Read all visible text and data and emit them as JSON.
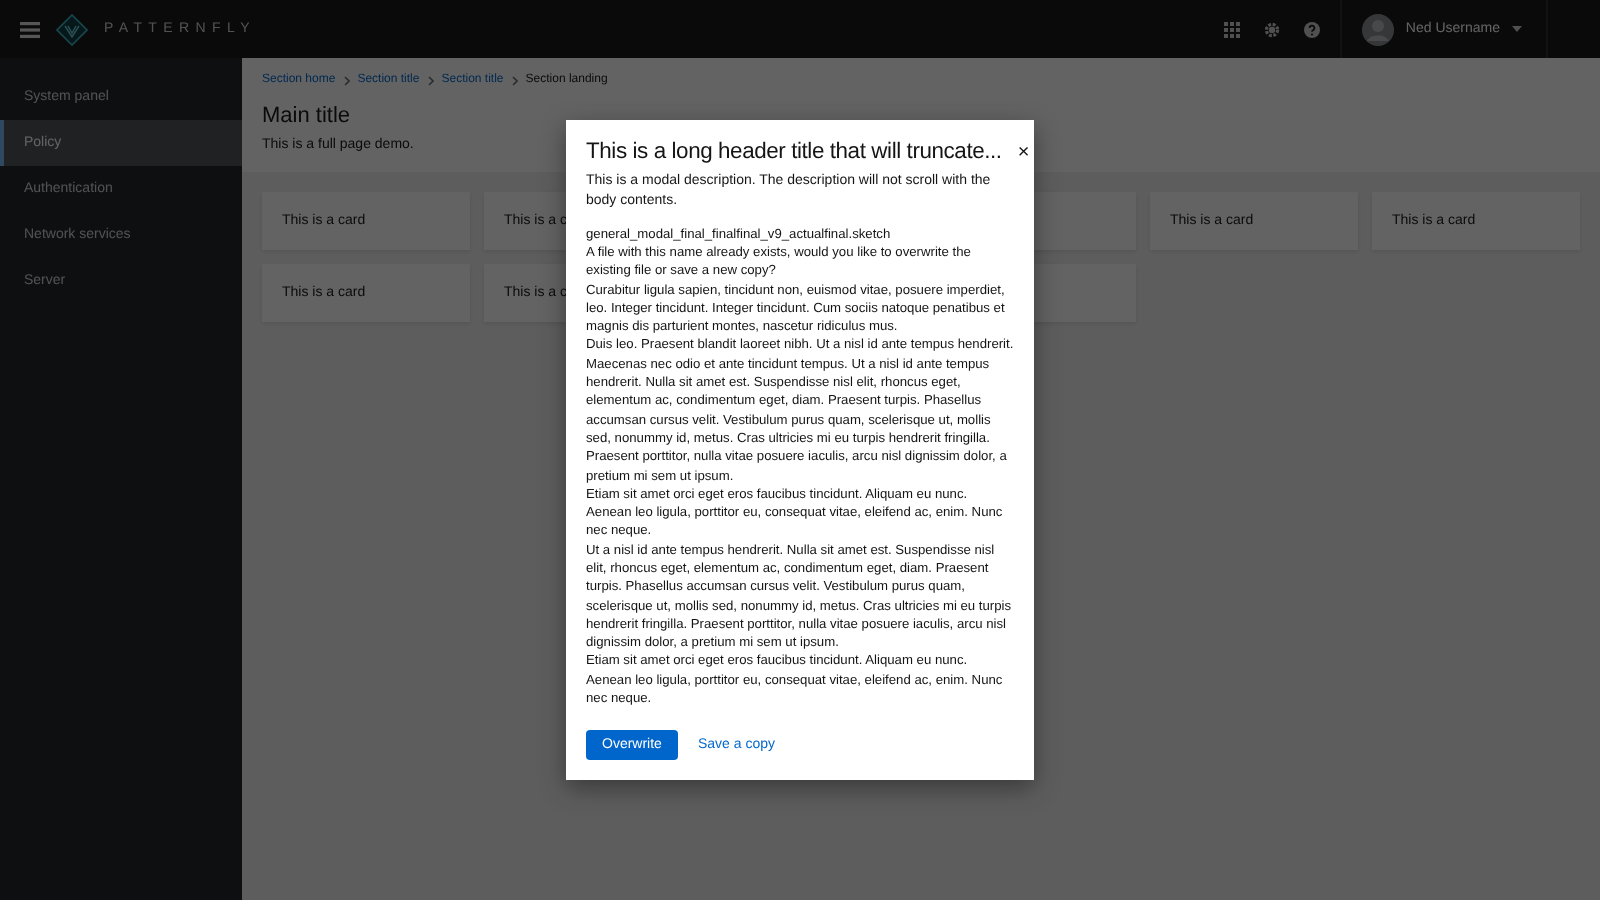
{
  "masthead": {
    "brand": "PATTERNFLY",
    "user": "Ned Username"
  },
  "sidebar": {
    "items": [
      {
        "label": "System panel",
        "selected": false
      },
      {
        "label": "Policy",
        "selected": true
      },
      {
        "label": "Authentication",
        "selected": false
      },
      {
        "label": "Network services",
        "selected": false
      },
      {
        "label": "Server",
        "selected": false
      }
    ]
  },
  "breadcrumb": [
    {
      "label": "Section home",
      "kind": "link"
    },
    {
      "label": "Section title",
      "kind": "link"
    },
    {
      "label": "Section title",
      "kind": "link"
    },
    {
      "label": "Section landing",
      "kind": "current"
    }
  ],
  "page": {
    "title": "Main title",
    "description": "This is a full page demo."
  },
  "card_rows": [
    {
      "cards": [
        {
          "kind": "text",
          "label": "This is a card"
        },
        {
          "kind": "text",
          "label": "This is a c"
        },
        {
          "kind": "covered"
        },
        {
          "kind": "covered"
        },
        {
          "kind": "text",
          "label": "This is a card"
        },
        {
          "kind": "text",
          "label": "This is a card"
        }
      ]
    },
    {
      "cards": [
        {
          "kind": "text",
          "label": "This is a card"
        },
        {
          "kind": "text",
          "label": "This is a c"
        },
        {
          "kind": "covered"
        },
        {
          "kind": "covered"
        }
      ]
    }
  ],
  "modal": {
    "title": "This is a long header title that will truncate...",
    "close": "×",
    "description": "This is a modal description. The description will not scroll with the body contents.",
    "filename": "general_modal_final_finalfinal_v9_actualfinal.sketch",
    "paragraphs": [
      "A file with this name already exists, would you like to overwrite the existing file or save a new copy?",
      "Curabitur ligula sapien, tincidunt non, euismod vitae, posuere imperdiet, leo. Integer tincidunt. Integer tincidunt. Cum sociis natoque penatibus et magnis dis parturient montes, nascetur ridiculus mus.",
      "Duis leo. Praesent blandit laoreet nibh. Ut a nisl id ante tempus hendrerit. Maecenas nec odio et ante tincidunt tempus. Ut a nisl id ante tempus hendrerit. Nulla sit amet est. Suspendisse nisl elit, rhoncus eget, elementum ac, condimentum eget, diam. Praesent turpis. Phasellus accumsan cursus velit. Vestibulum purus quam, scelerisque ut, mollis sed, nonummy id, metus. Cras ultricies mi eu turpis hendrerit fringilla. Praesent porttitor, nulla vitae posuere iaculis, arcu nisl dignissim dolor, a pretium mi sem ut ipsum.",
      "Etiam sit amet orci eget eros faucibus tincidunt. Aliquam eu nunc. Aenean leo ligula, porttitor eu, consequat vitae, eleifend ac, enim. Nunc nec neque.",
      "Ut a nisl id ante tempus hendrerit. Nulla sit amet est. Suspendisse nisl elit, rhoncus eget, elementum ac, condimentum eget, diam. Praesent turpis. Phasellus accumsan cursus velit. Vestibulum purus quam, scelerisque ut, mollis sed, nonummy id, metus. Cras ultricies mi eu turpis hendrerit fringilla. Praesent porttitor, nulla vitae posuere iaculis, arcu nisl dignissim dolor, a pretium mi sem ut ipsum.",
      "Etiam sit amet orci eget eros faucibus tincidunt. Aliquam eu nunc. Aenean leo ligula, porttitor eu, consequat vitae, eleifend ac, enim. Nunc nec neque."
    ],
    "actions": [
      {
        "label": "Overwrite",
        "kind": "primary"
      },
      {
        "label": "Save a copy",
        "kind": "link"
      }
    ]
  }
}
